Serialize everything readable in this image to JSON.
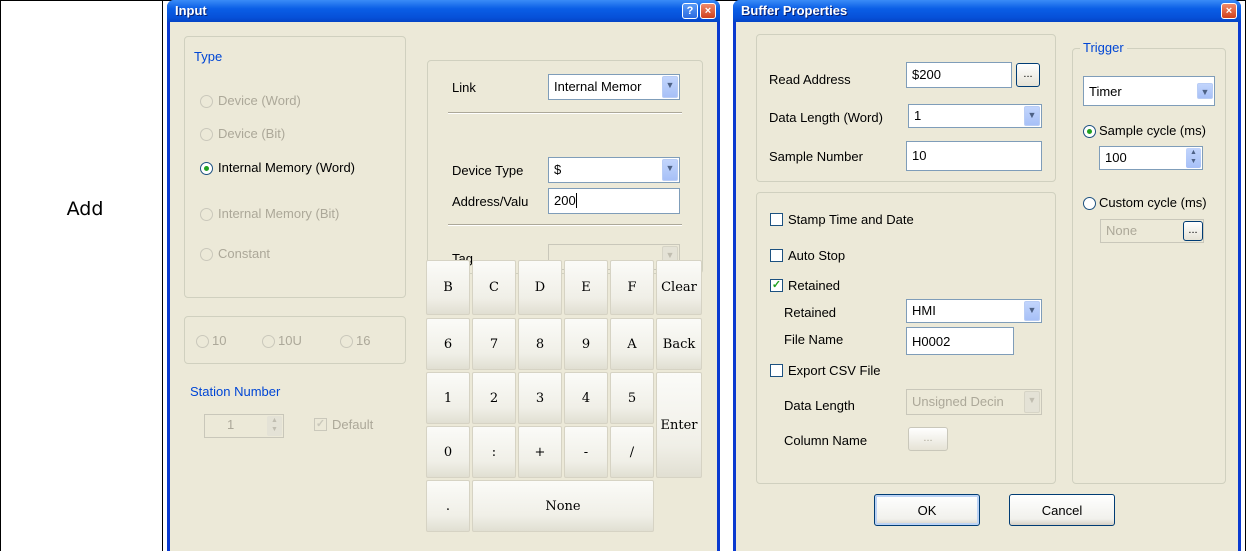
{
  "row_label": "Add",
  "input_dialog": {
    "title": "Input",
    "help_icon": "?",
    "close_icon": "×",
    "type_group": {
      "label": "Type",
      "options": [
        "Device (Word)",
        "Device (Bit)",
        "Internal Memory (Word)",
        "Internal Memory (Bit)",
        "Constant"
      ],
      "selected": "Internal Memory (Word)"
    },
    "base_options": [
      "10",
      "10U",
      "16"
    ],
    "link": {
      "label": "Link",
      "value": "Internal Memor"
    },
    "device_type": {
      "label": "Device Type",
      "value": "$"
    },
    "address": {
      "label": "Address/Valu",
      "value": "200"
    },
    "tag": {
      "label": "Tag",
      "value": ""
    },
    "station": {
      "label": "Station Number",
      "value": "1",
      "default_label": "Default"
    },
    "keypad": {
      "row1": [
        "B",
        "C",
        "D",
        "E",
        "F",
        "Clear"
      ],
      "row2": [
        "6",
        "7",
        "8",
        "9",
        "A",
        "Back"
      ],
      "row3": [
        "1",
        "2",
        "3",
        "4",
        "5"
      ],
      "row4": [
        "0",
        ":",
        "+",
        "-",
        "/"
      ],
      "enter": "Enter",
      "dot": ".",
      "none": "None"
    }
  },
  "buffer_dialog": {
    "title": "Buffer Properties",
    "close_icon": "×",
    "read_address": {
      "label": "Read Address",
      "value": "$200",
      "browse": "..."
    },
    "data_length": {
      "label": "Data Length (Word)",
      "value": "1"
    },
    "sample_number": {
      "label": "Sample Number",
      "value": "10"
    },
    "stamp_time": {
      "label": "Stamp Time and Date",
      "checked": false
    },
    "auto_stop": {
      "label": "Auto Stop",
      "checked": false
    },
    "retained": {
      "label": "Retained",
      "checked": true
    },
    "retained_select": {
      "label": "Retained",
      "value": "HMI"
    },
    "file_name": {
      "label": "File Name",
      "value": "H0002"
    },
    "export_csv": {
      "label": "Export CSV File",
      "checked": false
    },
    "csv_data_length": {
      "label": "Data Length",
      "value": "Unsigned Decin"
    },
    "column_name": {
      "label": "Column Name",
      "button": "..."
    },
    "trigger": {
      "label": "Trigger",
      "type": "Timer",
      "sample_cycle": {
        "label": "Sample cycle (ms)",
        "value": "100",
        "selected": true
      },
      "custom_cycle": {
        "label": "Custom cycle (ms)",
        "value": "None",
        "button": "..."
      }
    },
    "ok": "OK",
    "cancel": "Cancel"
  }
}
